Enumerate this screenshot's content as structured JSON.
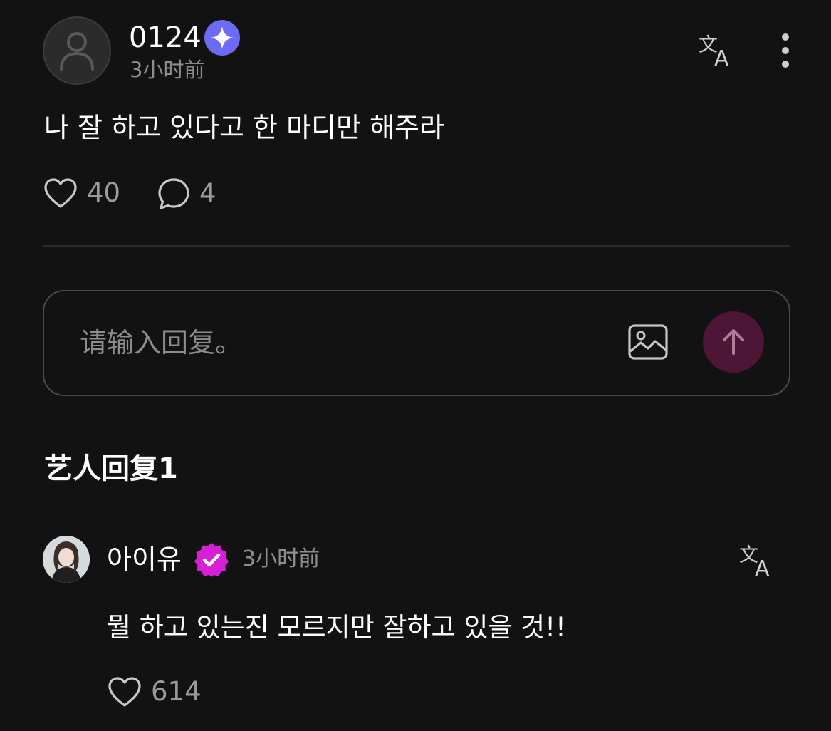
{
  "post": {
    "username": "0124",
    "time": "3小时前",
    "body": "나 잘 하고 있다고 한 마디만 해주라",
    "likes": "40",
    "comments": "4"
  },
  "composer": {
    "placeholder": "请输入回复。"
  },
  "section": {
    "title": "艺人回复1"
  },
  "reply": {
    "username": "아이유",
    "time": "3小时前",
    "body": "뭘 하고 있는진 모르지만 잘하고 있을 것!!",
    "likes": "614"
  },
  "colors": {
    "background": "#121212",
    "fan_badge": "#6b6bf5",
    "verified_badge": "#d61fd6",
    "send_button": "#4d1536"
  },
  "icons": {
    "fan_badge": "sparkle-icon",
    "verified_badge": "verified-check-icon",
    "translate": "translate-icon",
    "more": "more-vertical-icon",
    "like": "heart-icon",
    "comment": "comment-icon",
    "image": "image-icon",
    "send": "arrow-up-icon"
  }
}
